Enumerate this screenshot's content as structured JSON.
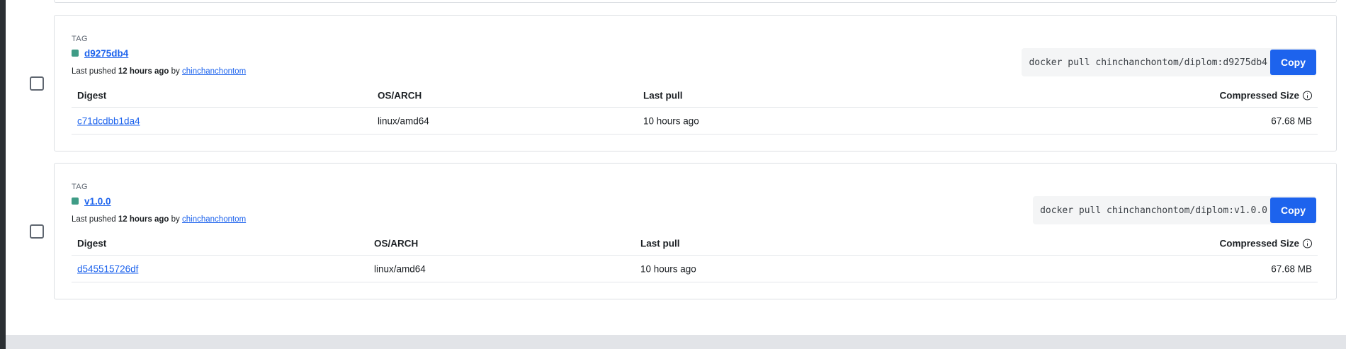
{
  "tags": [
    {
      "section_label": "TAG",
      "name": "d9275db4",
      "pushed_prefix": "Last pushed",
      "pushed_time": "12 hours ago",
      "pushed_by_word": "by",
      "pushed_by_user": "chinchanchontom",
      "pull_command": "docker pull chinchanchontom/diplom:d9275db4",
      "copy_label": "Copy",
      "table": {
        "headers": {
          "digest": "Digest",
          "os_arch": "OS/ARCH",
          "last_pull": "Last pull",
          "size": "Compressed Size"
        },
        "rows": [
          {
            "digest": "c71dcdbb1da4",
            "os_arch": "linux/amd64",
            "last_pull": "10 hours ago",
            "size": "67.68 MB"
          }
        ]
      }
    },
    {
      "section_label": "TAG",
      "name": "v1.0.0",
      "pushed_prefix": "Last pushed",
      "pushed_time": "12 hours ago",
      "pushed_by_word": "by",
      "pushed_by_user": "chinchanchontom",
      "pull_command": "docker pull chinchanchontom/diplom:v1.0.0",
      "copy_label": "Copy",
      "table": {
        "headers": {
          "digest": "Digest",
          "os_arch": "OS/ARCH",
          "last_pull": "Last pull",
          "size": "Compressed Size"
        },
        "rows": [
          {
            "digest": "d545515726df",
            "os_arch": "linux/amd64",
            "last_pull": "10 hours ago",
            "size": "67.68 MB"
          }
        ]
      }
    }
  ],
  "colors": {
    "accent": "#1d63ed",
    "status_dot": "#3f9c86",
    "border": "#dcdfe3",
    "footer": "#e2e4e8"
  },
  "icons": {
    "status": "status-square-icon",
    "info": "info-circle-icon"
  }
}
